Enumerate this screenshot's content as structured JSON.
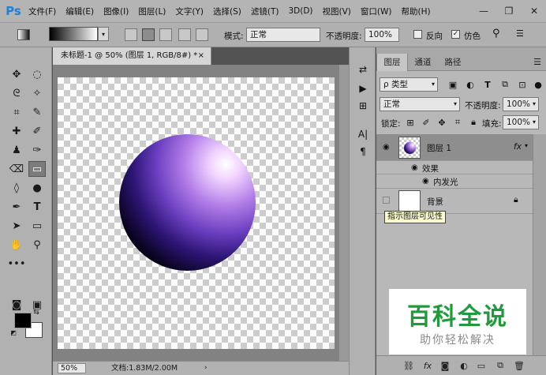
{
  "app": {
    "logo": "Ps"
  },
  "menu": [
    "文件(F)",
    "编辑(E)",
    "图像(I)",
    "图层(L)",
    "文字(Y)",
    "选择(S)",
    "滤镜(T)",
    "3D(D)",
    "视图(V)",
    "窗口(W)",
    "帮助(H)"
  ],
  "window_controls": {
    "minimize": "—",
    "restore": "❐",
    "close": "✕"
  },
  "options": {
    "mode_label": "模式:",
    "mode_value": "正常",
    "opacity_label": "不透明度:",
    "opacity_value": "100%",
    "reverse_label": "反向",
    "dither_label": "仿色",
    "dither_checked": true,
    "reverse_checked": false
  },
  "document": {
    "tab_title": "未标题-1 @ 50% (图层 1, RGB/8#) *",
    "tab_close": "×",
    "zoom": "50%",
    "doc_info": "文档:1.83M/2.00M",
    "status_arrow": "›"
  },
  "panel": {
    "tabs": [
      "图层",
      "通道",
      "路径"
    ],
    "filter_label": "ρ 类型",
    "blend_mode": "正常",
    "opacity_label": "不透明度:",
    "opacity_value": "100%",
    "lock_label": "锁定:",
    "fill_label": "填充:",
    "fill_value": "100%",
    "layers": [
      {
        "name": "图层 1",
        "fx": "fx",
        "selected": true
      },
      {
        "name": "背景",
        "locked": true
      }
    ],
    "effects_label": "效果",
    "inner_glow_label": "内发光",
    "tooltip": "指示图层可见性"
  },
  "watermark": {
    "main": "百科全说",
    "sub": "助你轻松解决"
  },
  "colors": {
    "accent_ps": "#1f7fd9",
    "watermark_green": "#1f9a3c"
  }
}
